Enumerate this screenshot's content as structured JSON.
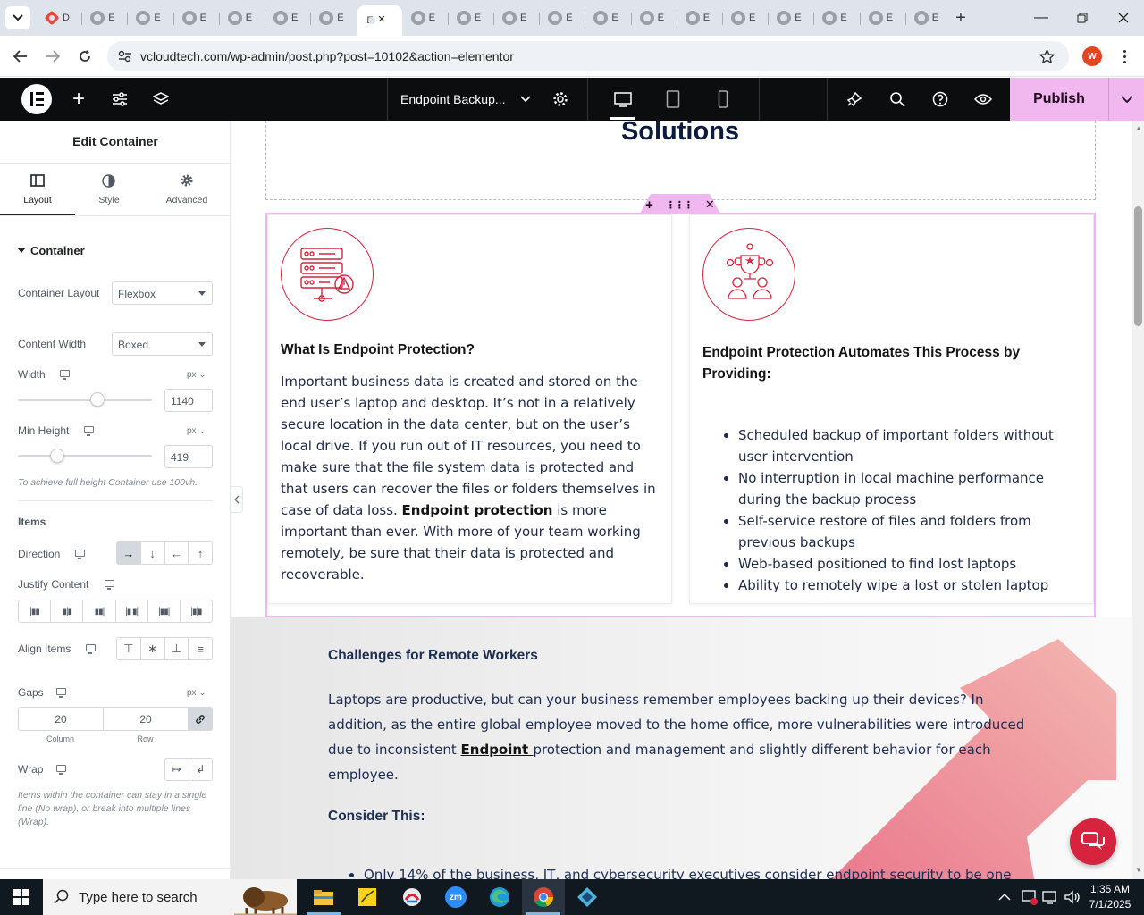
{
  "browser": {
    "tabs": [
      {
        "label": "D"
      },
      {
        "label": "E"
      },
      {
        "label": "E"
      },
      {
        "label": "E"
      },
      {
        "label": "E"
      },
      {
        "label": "E"
      },
      {
        "label": "E"
      },
      {
        "label": "E"
      },
      {
        "label": "E"
      },
      {
        "label": "E"
      },
      {
        "label": "E"
      },
      {
        "label": "E"
      },
      {
        "label": "E"
      },
      {
        "label": "E"
      },
      {
        "label": "E"
      },
      {
        "label": "E"
      },
      {
        "label": "E"
      },
      {
        "label": "E"
      },
      {
        "label": "E"
      },
      {
        "label": "E"
      }
    ],
    "active_tab_index": 7,
    "url": "vcloudtech.com/wp-admin/post.php?post=10102&action=elementor",
    "profile_initial": "W"
  },
  "elementor": {
    "page_title": "Endpoint Backup...",
    "publish_label": "Publish"
  },
  "panel": {
    "title": "Edit Container",
    "tabs": [
      "Layout",
      "Style",
      "Advanced"
    ],
    "section": "Container",
    "container_layout_label": "Container Layout",
    "container_layout_value": "Flexbox",
    "content_width_label": "Content Width",
    "content_width_value": "Boxed",
    "width_label": "Width",
    "width_unit": "px",
    "width_value": "1140",
    "width_slider_fraction": 0.59,
    "min_height_label": "Min Height",
    "min_height_unit": "px",
    "min_height_value": "419",
    "min_height_slider_fraction": 0.29,
    "min_height_help": "To achieve full height Container use 100vh.",
    "items_heading": "Items",
    "direction_label": "Direction",
    "justify_label": "Justify Content",
    "align_label": "Align Items",
    "gaps_label": "Gaps",
    "gaps_unit": "px",
    "gap_column": "20",
    "gap_row": "20",
    "gap_column_label": "Column",
    "gap_row_label": "Row",
    "wrap_label": "Wrap",
    "wrap_help": "Items within the container can stay in a single line (No wrap), or break into multiple lines (Wrap)."
  },
  "canvas": {
    "top_heading": "Solutions",
    "card_left": {
      "title": "What Is Endpoint Protection?",
      "para_before_link": "Important business data is created and stored on the end user’s laptop and desktop. It’s not in a relatively secure location in the data center, but on the user’s local drive. If you run out of IT resources, you need to make sure that the file system data is protected and that users can recover the files or folders themselves in case of data loss. ",
      "link": "Endpoint protection",
      "para_after_link": " is more important than ever. With more of your team working remotely, be sure that their data is protected and recoverable."
    },
    "card_right": {
      "title": "Endpoint Protection Automates This Process by Providing:",
      "bullets": [
        "Scheduled backup of important folders without user intervention",
        "No interruption in local machine performance during the backup process",
        "Self-service restore of files and folders from previous backups",
        "Web-based positioned to find lost laptops",
        "Ability to remotely wipe a lost or stolen laptop"
      ]
    },
    "challenges": {
      "title": "Challenges for Remote Workers",
      "para_before_link": "Laptops are productive, but can your business remember employees backing up their devices? In addition, as the entire global employee moved to the home office, more vulnerabilities were introduced due to inconsistent ",
      "link": "Endpoint ",
      "para_after_link": "protection and management and slightly different behavior for each employee.",
      "consider": "Consider This:",
      "bullet": "Only 14% of the business, IT, and cybersecurity executives consider endpoint security to be one"
    }
  },
  "taskbar": {
    "search_placeholder": "Type here to search",
    "time": "1:35 AM",
    "date": "7/1/2025"
  },
  "colors": {
    "elementor_black": "#0c0d0e",
    "publish_pink": "#f1b7ef",
    "brand_red": "#d6243f",
    "heading_navy": "#0d1b3e"
  }
}
